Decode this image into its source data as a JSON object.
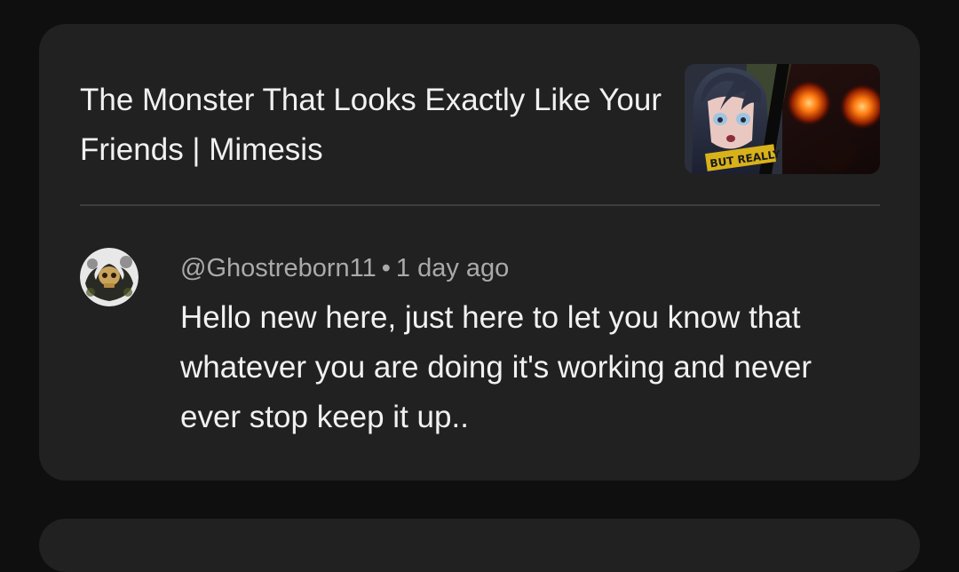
{
  "video": {
    "title": "The Monster That Looks Exactly Like Your Friends | Mimesis",
    "thumbnail_icon": "video-thumbnail",
    "thumbnail_text": "BUT REALLY"
  },
  "comment": {
    "author": "@Ghostreborn11",
    "separator": "•",
    "time": "1 day ago",
    "text": "Hello new here, just here to let you know that whatever you are doing it's working and never ever stop keep it up..",
    "avatar_icon": "skull-avatar"
  },
  "colors": {
    "background": "#0f0f0f",
    "card": "#212121",
    "primary_text": "#f1f1f1",
    "secondary_text": "#aaaaaa",
    "divider": "#3d3d3d",
    "glow": "#ff6a00"
  }
}
